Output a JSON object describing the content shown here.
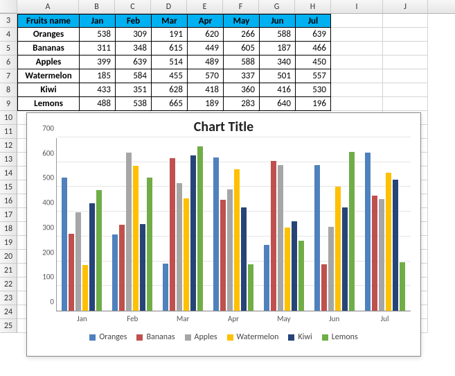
{
  "columns_letters": [
    "A",
    "B",
    "C",
    "D",
    "E",
    "F",
    "G",
    "H",
    "I",
    "J"
  ],
  "row_numbers": [
    3,
    4,
    5,
    6,
    7,
    8,
    9,
    10,
    11,
    12,
    13,
    14,
    15,
    16,
    17,
    18,
    19,
    20,
    21,
    22,
    23,
    24,
    25
  ],
  "table": {
    "header_label": "Fruits name",
    "months": [
      "Jan",
      "Feb",
      "Mar",
      "Apr",
      "May",
      "Jun",
      "Jul"
    ],
    "rows": [
      {
        "name": "Oranges",
        "vals": [
          538,
          309,
          191,
          620,
          266,
          588,
          639
        ]
      },
      {
        "name": "Bananas",
        "vals": [
          311,
          348,
          615,
          449,
          605,
          187,
          466
        ]
      },
      {
        "name": "Apples",
        "vals": [
          399,
          639,
          514,
          489,
          588,
          340,
          450
        ]
      },
      {
        "name": "Watermelon",
        "vals": [
          185,
          584,
          455,
          570,
          337,
          501,
          557
        ]
      },
      {
        "name": "Kiwi",
        "vals": [
          433,
          351,
          628,
          418,
          360,
          416,
          530
        ]
      },
      {
        "name": "Lemons",
        "vals": [
          488,
          538,
          665,
          189,
          283,
          640,
          196
        ]
      }
    ]
  },
  "chart_data": {
    "type": "bar",
    "title": "Chart Title",
    "categories": [
      "Jan",
      "Feb",
      "Mar",
      "Apr",
      "May",
      "Jun",
      "Jul"
    ],
    "series": [
      {
        "name": "Oranges",
        "color": "#4f81bd",
        "values": [
          538,
          309,
          191,
          620,
          266,
          588,
          639
        ]
      },
      {
        "name": "Bananas",
        "color": "#c0504d",
        "values": [
          311,
          348,
          615,
          449,
          605,
          187,
          466
        ]
      },
      {
        "name": "Apples",
        "color": "#9bbb59",
        "fill": "#a6a6a6",
        "values": [
          399,
          639,
          514,
          489,
          588,
          340,
          450
        ]
      },
      {
        "name": "Watermelon",
        "color": "#ffc000",
        "values": [
          185,
          584,
          455,
          570,
          337,
          501,
          557
        ]
      },
      {
        "name": "Kiwi",
        "color": "#4472c4",
        "fill": "#264478",
        "values": [
          433,
          351,
          628,
          418,
          360,
          416,
          530
        ]
      },
      {
        "name": "Lemons",
        "color": "#70ad47",
        "values": [
          488,
          538,
          665,
          189,
          283,
          640,
          196
        ]
      }
    ],
    "ylim": [
      0,
      700
    ],
    "yticks": [
      0,
      100,
      200,
      300,
      400,
      500,
      600,
      700
    ],
    "xlabel": "",
    "ylabel": ""
  }
}
